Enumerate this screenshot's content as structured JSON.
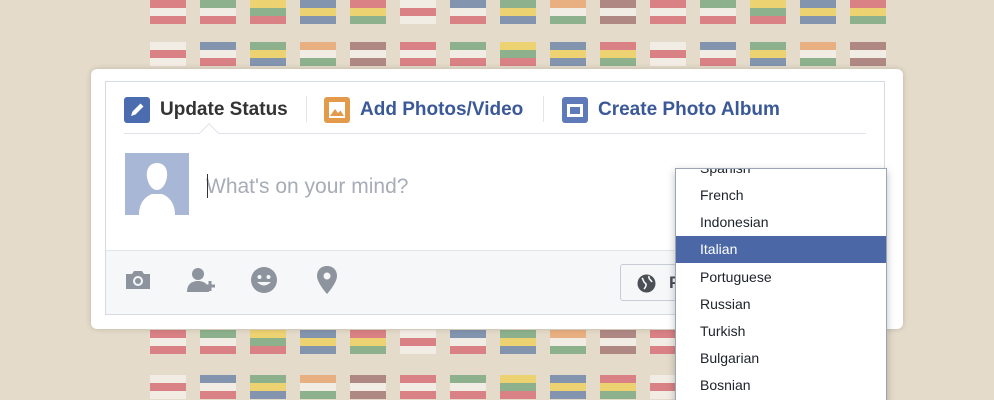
{
  "status_tabs": {
    "update_status": {
      "label": "Update Status",
      "icon": "pencil-icon"
    },
    "add_photos": {
      "label": "Add Photos/Video",
      "icon": "photo-icon"
    },
    "create_album": {
      "label": "Create Photo Album",
      "icon": "album-icon"
    }
  },
  "composer": {
    "placeholder": "What's on your mind?",
    "avatar": "default-profile-silhouette"
  },
  "footer_actions": [
    {
      "name": "camera-icon"
    },
    {
      "name": "tag-friends-icon"
    },
    {
      "name": "feeling-smiley-icon"
    },
    {
      "name": "location-pin-icon"
    }
  ],
  "audience_button": {
    "label": "P",
    "icon": "globe-icon"
  },
  "language_menu": {
    "selected": "Italian",
    "options": [
      "Spanish",
      "French",
      "Indonesian",
      "Italian",
      "Portuguese",
      "Russian",
      "Turkish",
      "Bulgarian",
      "Bosnian"
    ]
  },
  "colors": {
    "brand_blue": "#3b5998",
    "selected_item": "#4b67a6",
    "photo_icon": "#e39a4a"
  }
}
